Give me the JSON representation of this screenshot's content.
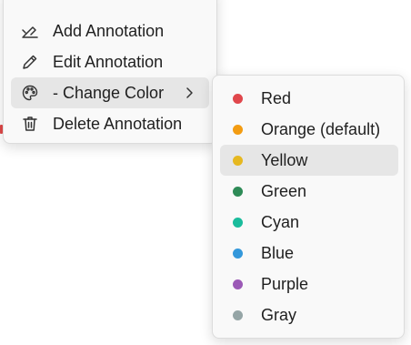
{
  "main_menu": {
    "items": [
      {
        "label": "Add Annotation",
        "icon": "add-annotation-icon"
      },
      {
        "label": "Edit Annotation",
        "icon": "pencil-icon"
      },
      {
        "label": "- Change Color",
        "icon": "palette-icon",
        "has_submenu": true
      },
      {
        "label": "Delete Annotation",
        "icon": "trash-icon"
      }
    ]
  },
  "color_menu": {
    "items": [
      {
        "label": "Red",
        "color": "#e0474c"
      },
      {
        "label": "Orange (default)",
        "color": "#f39c12"
      },
      {
        "label": "Yellow",
        "color": "#e6b820",
        "selected": true
      },
      {
        "label": "Green",
        "color": "#2e8b57"
      },
      {
        "label": "Cyan",
        "color": "#1abc9c"
      },
      {
        "label": "Blue",
        "color": "#3498db"
      },
      {
        "label": "Purple",
        "color": "#9b59b6"
      },
      {
        "label": "Gray",
        "color": "#95a5a6"
      }
    ]
  },
  "colors": {
    "menu_bg": "#f9f9f9",
    "hover_bg": "#e6e6e6",
    "text": "#1f1f1f"
  }
}
